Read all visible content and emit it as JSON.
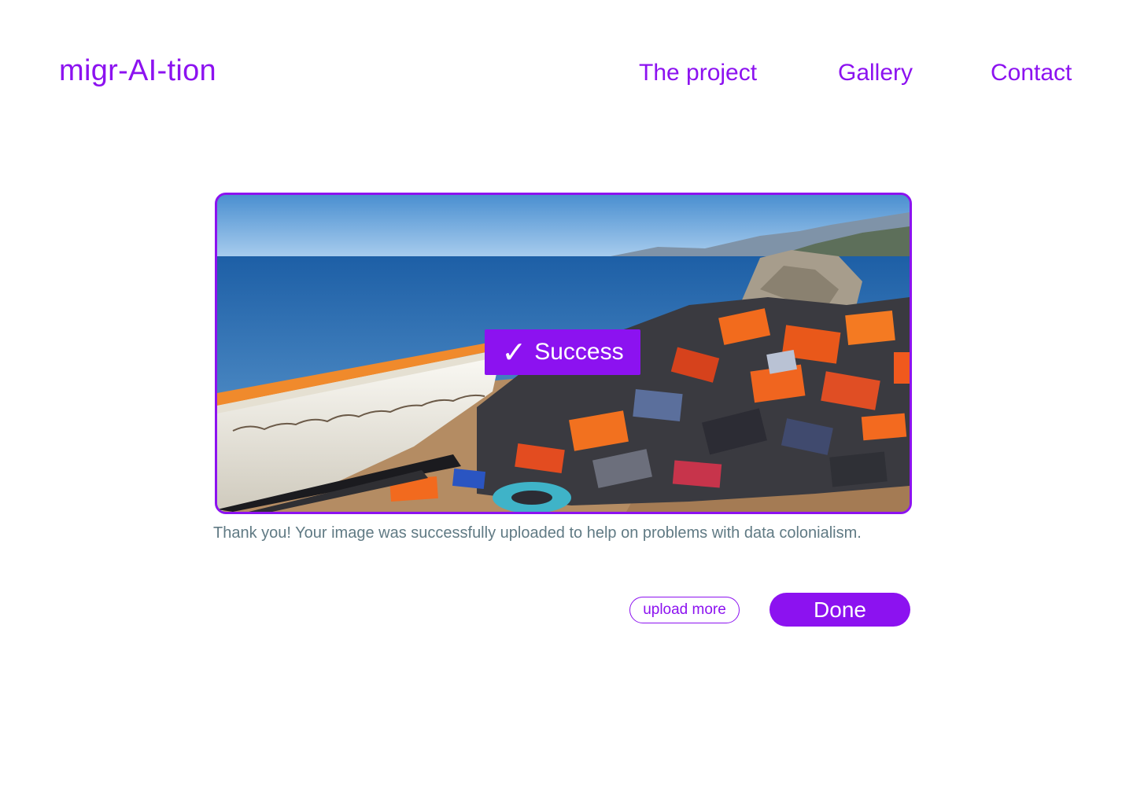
{
  "header": {
    "logo": "migr-AI-tion",
    "nav": [
      {
        "label": "The project"
      },
      {
        "label": "Gallery"
      },
      {
        "label": "Contact"
      }
    ]
  },
  "upload": {
    "image_subject": "beach with white boat and pile of discarded life jackets",
    "success_badge": {
      "icon": "check-icon",
      "label": "Success"
    },
    "message": "Thank you! Your image was successfully uploaded to help on problems with data colonialism."
  },
  "actions": {
    "upload_more_label": "upload more",
    "done_label": "Done"
  },
  "colors": {
    "accent": "#8c12f0",
    "message_text": "#607a84",
    "background": "#ffffff"
  }
}
